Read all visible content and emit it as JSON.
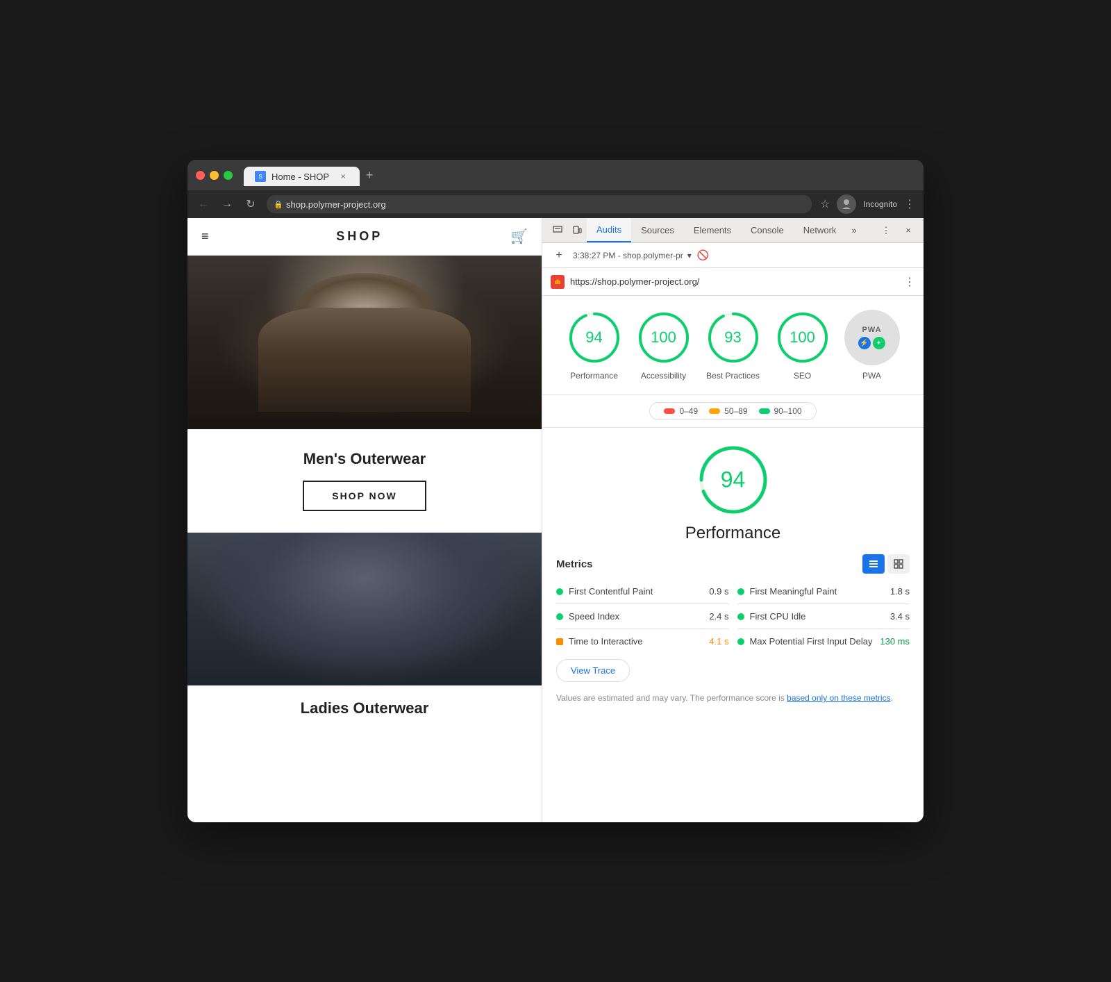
{
  "browser": {
    "traffic_lights": [
      "red",
      "yellow",
      "green"
    ],
    "tab": {
      "favicon": "🏪",
      "title": "Home - SHOP",
      "close": "×"
    },
    "new_tab": "+",
    "address": "shop.polymer-project.org",
    "back_btn": "←",
    "forward_btn": "→",
    "refresh_btn": "↻",
    "lock_icon": "🔒",
    "star_icon": "☆",
    "incognito_label": "Incognito",
    "menu_icon": "⋮"
  },
  "webpage": {
    "hamburger": "≡",
    "shop_logo": "SHOP",
    "cart_icon": "🛒",
    "mens_title": "Men's Outerwear",
    "shop_now_btn": "SHOP NOW",
    "ladies_title": "Ladies Outerwear"
  },
  "devtools": {
    "tabs": [
      {
        "label": "Audits",
        "active": true
      },
      {
        "label": "Sources",
        "active": false
      },
      {
        "label": "Elements",
        "active": false
      },
      {
        "label": "Console",
        "active": false
      },
      {
        "label": "Network",
        "active": false
      }
    ],
    "more_tabs": "»",
    "options_btn": "⋮",
    "close_btn": "×",
    "toolbar": {
      "add_btn": "+",
      "timestamp": "3:38:27 PM - shop.polymer-pr",
      "dropdown_arrow": "▾",
      "clear_btn": "🚫"
    },
    "audit_url": "https://shop.polymer-project.org/",
    "scores": [
      {
        "value": 94,
        "label": "Performance",
        "circumference": 251.2,
        "offset": 15.1
      },
      {
        "value": 100,
        "label": "Accessibility",
        "circumference": 251.2,
        "offset": 0
      },
      {
        "value": 93,
        "label": "Best Practices",
        "circumference": 251.2,
        "offset": 17.6
      },
      {
        "value": 100,
        "label": "SEO",
        "circumference": 251.2,
        "offset": 0
      }
    ],
    "pwa_label": "PWA",
    "legend": {
      "ranges": [
        {
          "color": "red",
          "label": "0–49"
        },
        {
          "color": "orange",
          "label": "50–89"
        },
        {
          "color": "green",
          "label": "90–100"
        }
      ]
    },
    "performance_detail": {
      "score": 94,
      "label": "Performance",
      "metrics_title": "Metrics",
      "metrics": [
        {
          "name": "First Contentful Paint",
          "value": "0.9 s",
          "color": "green",
          "col": "left"
        },
        {
          "name": "First Meaningful Paint",
          "value": "1.8 s",
          "color": "green",
          "col": "right"
        },
        {
          "name": "Speed Index",
          "value": "2.4 s",
          "color": "green",
          "col": "left"
        },
        {
          "name": "First CPU Idle",
          "value": "3.4 s",
          "color": "green",
          "col": "right"
        },
        {
          "name": "Time to Interactive",
          "value": "4.1 s",
          "color": "orange",
          "col": "left"
        },
        {
          "name": "Max Potential First Input Delay",
          "value": "130 ms",
          "color": "green",
          "col": "right"
        }
      ],
      "view_trace_btn": "View Trace",
      "note_text": "Values are estimated and may vary. The performance score is ",
      "note_link": "based only on these metrics",
      "note_end": "."
    }
  }
}
